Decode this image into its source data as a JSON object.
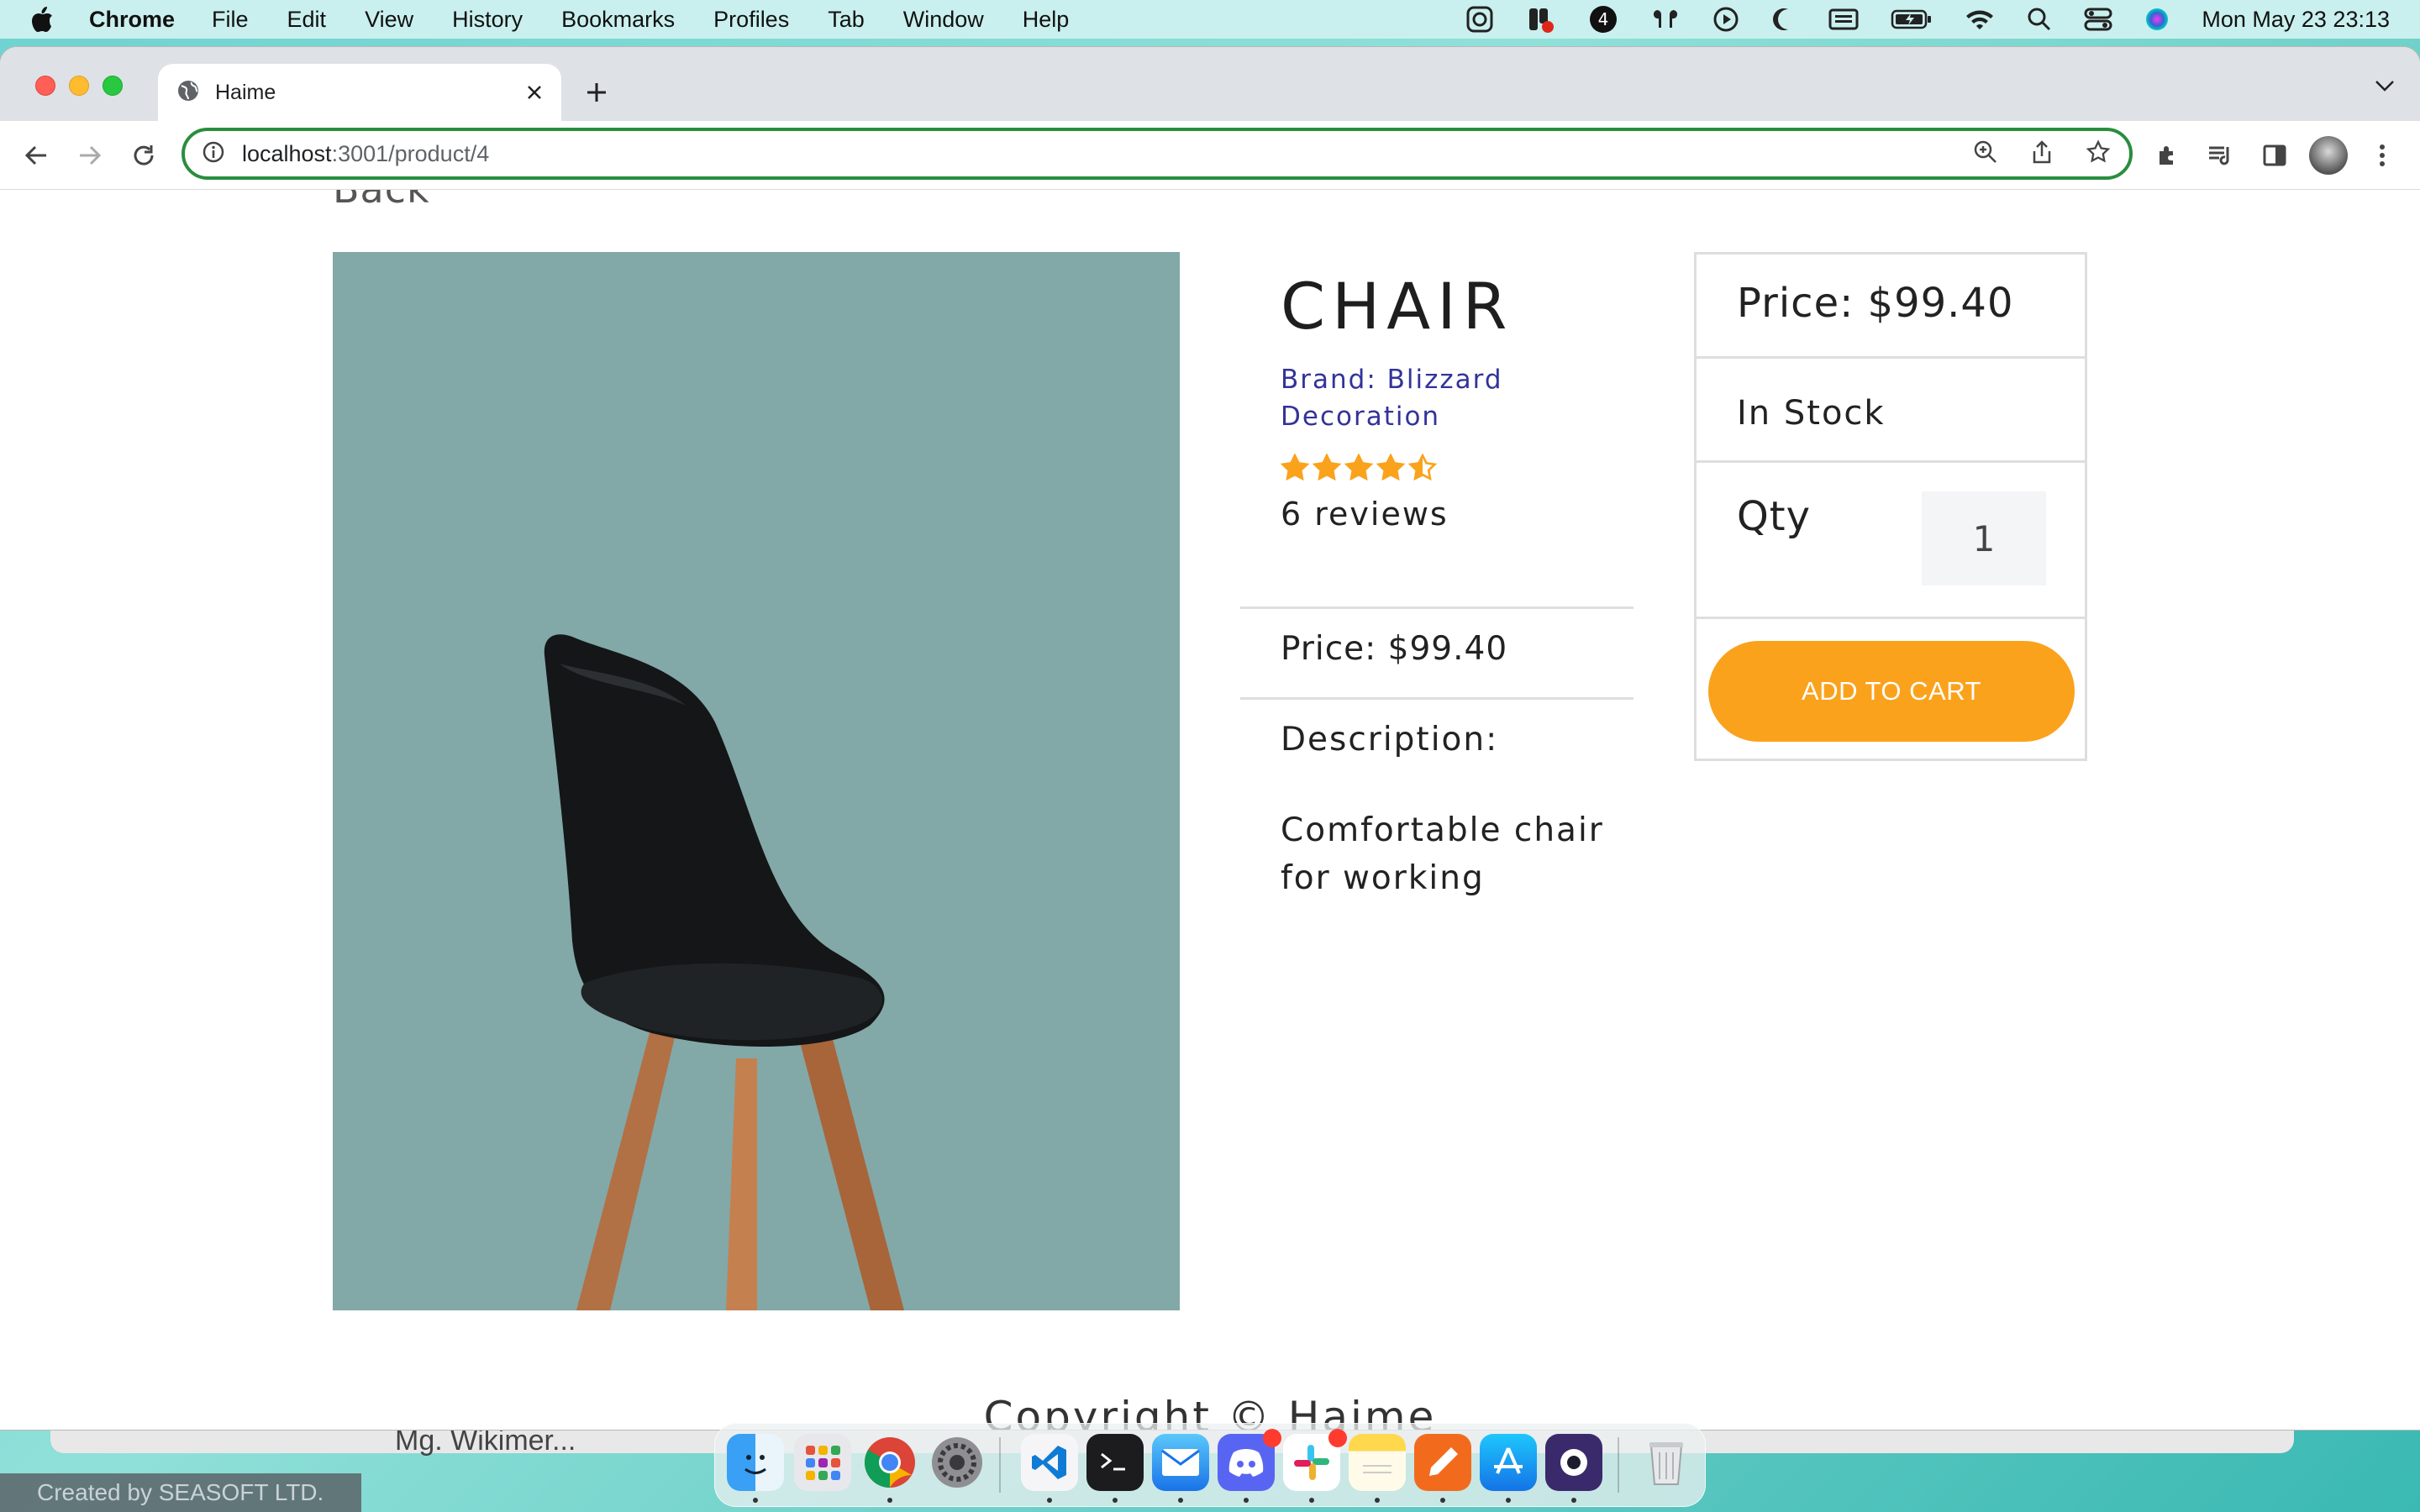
{
  "menubar": {
    "app_name": "Chrome",
    "items": [
      "File",
      "Edit",
      "View",
      "History",
      "Bookmarks",
      "Profiles",
      "Tab",
      "Window",
      "Help"
    ],
    "clock": "Mon May 23  23:13",
    "status_icons": [
      "screen-record-icon",
      "notification-app-icon",
      "app-4-icon",
      "airpods-icon",
      "play-icon",
      "moon-icon",
      "keyboard-icon",
      "battery-icon",
      "wifi-icon",
      "spotlight-icon",
      "control-center-icon",
      "siri-icon"
    ]
  },
  "browser": {
    "tab_title": "Haime",
    "url_host": "localhost",
    "url_path": ":3001/product/4"
  },
  "page": {
    "back_label": "Back",
    "product": {
      "name": "CHAIR",
      "brand": "Brand: Blizzard Decoration",
      "rating": 4.5,
      "rating_max": 5,
      "reviews": "6 reviews",
      "price": "Price: $99.40",
      "description_label": "Description:",
      "description": "Comfortable chair for working"
    },
    "cart": {
      "price": "Price: $99.40",
      "stock": "In Stock",
      "qty_label": "Qty",
      "qty_value": "1",
      "add_button": "ADD TO CART"
    },
    "footer": "Copyright © Haime"
  },
  "colors": {
    "accent_orange": "#fba21c",
    "brand_text": "#333399",
    "image_bg": "#83a8a8",
    "omnibox_border": "#2a8d3e"
  },
  "behind_window_text": "Mg. Wikimer...",
  "dock": {
    "apps": [
      "finder-icon",
      "launchpad-icon",
      "chrome-icon",
      "system-preferences-icon",
      "vscode-icon",
      "terminal-icon",
      "mail-icon",
      "discord-icon",
      "slack-icon",
      "notes-icon",
      "pencil-app-icon",
      "app-store-icon",
      "screen-recorder-icon",
      "trash-icon"
    ]
  },
  "watermark": "Created by SEASOFT LTD."
}
